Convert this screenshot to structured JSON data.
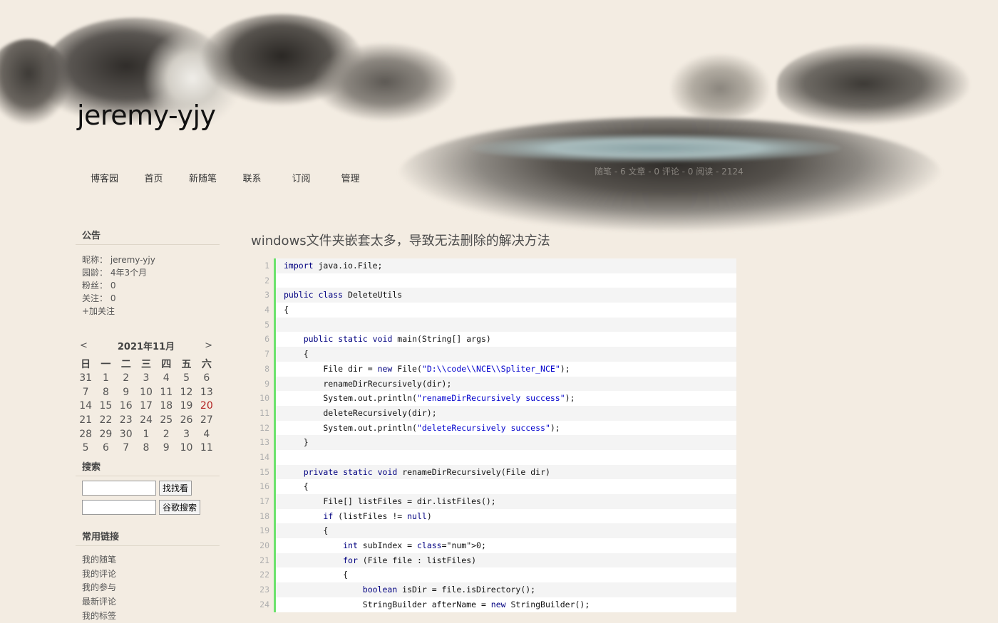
{
  "header": {
    "blog_title": "jeremy-yjy",
    "nav": [
      "博客园",
      "首页",
      "新随笔",
      "联系",
      "订阅",
      "管理"
    ],
    "stats": "随笔 - 6  文章 - 0  评论 - 0  阅读 - 2124"
  },
  "sidebar": {
    "notice": {
      "title": "公告",
      "nickname": "昵称：  jeremy-yjy",
      "age": "园龄：  4年3个月",
      "fans": "粉丝：  0",
      "follow": "关注：  0",
      "add_follow": "+加关注"
    },
    "calendar": {
      "prev": "<",
      "next": ">",
      "title": "2021年11月",
      "weekdays": [
        "日",
        "一",
        "二",
        "三",
        "四",
        "五",
        "六"
      ],
      "weeks": [
        [
          "31",
          "1",
          "2",
          "3",
          "4",
          "5",
          "6"
        ],
        [
          "7",
          "8",
          "9",
          "10",
          "11",
          "12",
          "13"
        ],
        [
          "14",
          "15",
          "16",
          "17",
          "18",
          "19",
          "20"
        ],
        [
          "21",
          "22",
          "23",
          "24",
          "25",
          "26",
          "27"
        ],
        [
          "28",
          "29",
          "30",
          "1",
          "2",
          "3",
          "4"
        ],
        [
          "5",
          "6",
          "7",
          "8",
          "9",
          "10",
          "11"
        ]
      ],
      "highlight_color": "#b22222"
    },
    "search": {
      "title": "搜索",
      "button_1": "找找看",
      "button_2": "谷歌搜索",
      "input_1_value": "",
      "input_2_value": ""
    },
    "links": {
      "title": "常用链接",
      "items": [
        "我的随笔",
        "我的评论",
        "我的参与",
        "最新评论",
        "我的标签"
      ]
    }
  },
  "post": {
    "title": "windows文件夹嵌套太多，导致无法删除的解决方法",
    "code_lines": [
      "import java.io.File;",
      "",
      "public class DeleteUtils",
      "{",
      "",
      "    public static void main(String[] args)",
      "    {",
      "        File dir = new File(\"D:\\\\code\\\\NCE\\\\Spliter_NCE\");",
      "        renameDirRecursively(dir);",
      "        System.out.println(\"renameDirRecursively success\");",
      "        deleteRecursively(dir);",
      "        System.out.println(\"deleteRecursively success\");",
      "    }",
      "",
      "    private static void renameDirRecursively(File dir)",
      "    {",
      "        File[] listFiles = dir.listFiles();",
      "        if (listFiles != null)",
      "        {",
      "            int subIndex = 0;",
      "            for (File file : listFiles)",
      "            {",
      "                boolean isDir = file.isDirectory();",
      "                StringBuilder afterName = new StringBuilder();"
    ],
    "gutter_color": "#6ce26c"
  }
}
